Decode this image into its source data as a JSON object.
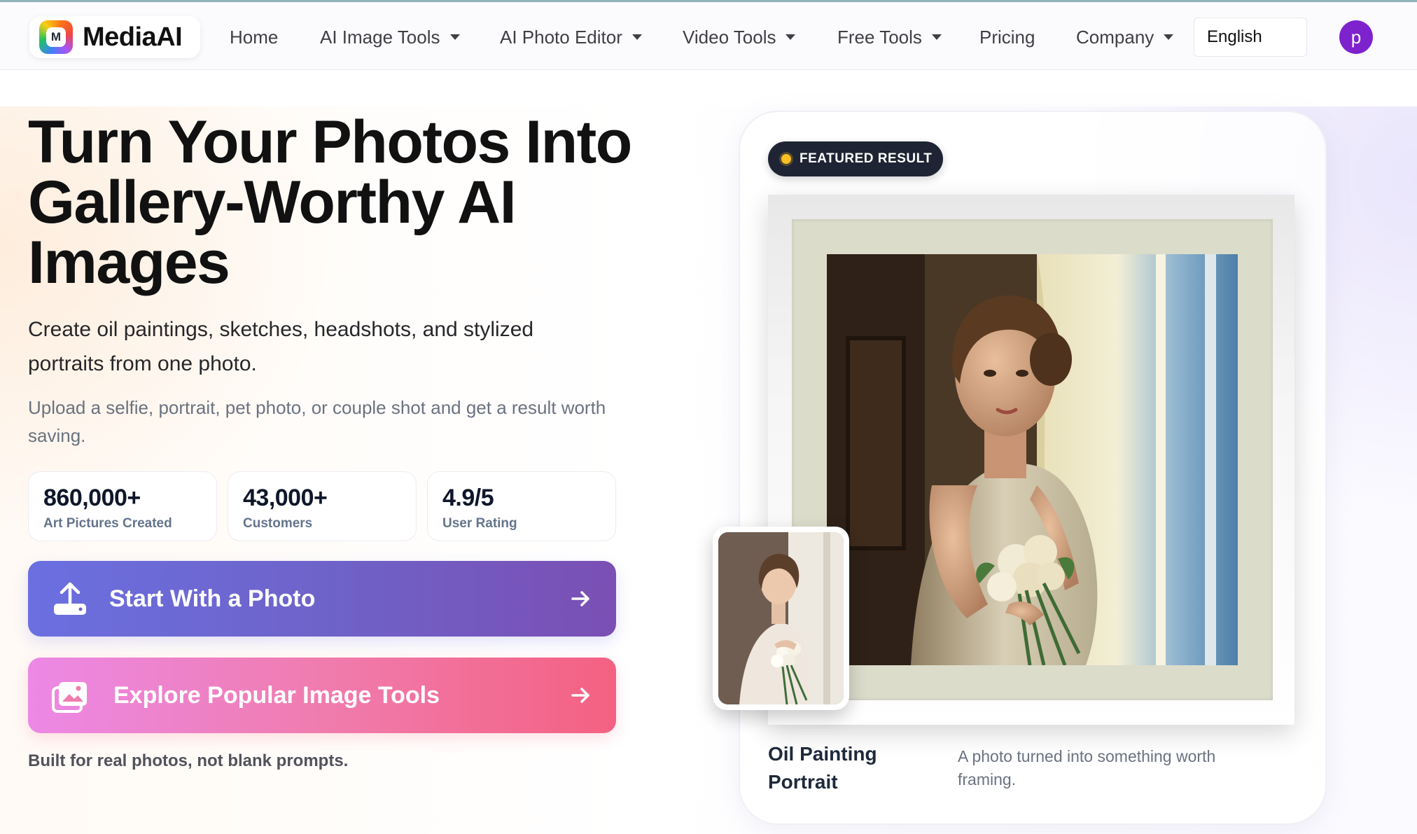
{
  "brand": {
    "name": "MediaAI",
    "mark": "M"
  },
  "nav": {
    "items": [
      {
        "label": "Home",
        "dropdown": false
      },
      {
        "label": "AI Image Tools",
        "dropdown": true
      },
      {
        "label": "AI Photo Editor",
        "dropdown": true
      },
      {
        "label": "Video Tools",
        "dropdown": true
      },
      {
        "label": "Free Tools",
        "dropdown": true
      },
      {
        "label": "Pricing",
        "dropdown": false
      },
      {
        "label": "Company",
        "dropdown": true
      }
    ],
    "language": "English",
    "avatar_initial": "p"
  },
  "hero": {
    "title": "Turn Your Photos Into Gallery-Worthy AI Images",
    "subtitle": "Create oil paintings, sketches, headshots, and stylized portraits from one photo.",
    "description": "Upload a selfie, portrait, pet photo, or couple shot and get a result worth saving.",
    "stats": [
      {
        "value": "860,000+",
        "label": "Art Pictures Created"
      },
      {
        "value": "43,000+",
        "label": "Customers"
      },
      {
        "value": "4.9/5",
        "label": "User Rating"
      }
    ],
    "primary_cta": {
      "label": "Start With a Photo",
      "icon": "upload-icon"
    },
    "secondary_cta": {
      "label": "Explore Popular Image Tools",
      "icon": "gallery-icon"
    },
    "tagline": "Built for real photos, not blank prompts."
  },
  "featured": {
    "badge": "FEATURED RESULT",
    "caption_title": "Oil Painting Portrait",
    "caption_text": "A photo turned into something worth framing."
  },
  "colors": {
    "primary_gradient": [
      "#6b6fe0",
      "#7b4fb4"
    ],
    "secondary_gradient": [
      "#ec89e6",
      "#f46182"
    ],
    "badge_bg": "#1e2433",
    "badge_dot": "#fbbf24",
    "avatar": "#7e22ce"
  }
}
